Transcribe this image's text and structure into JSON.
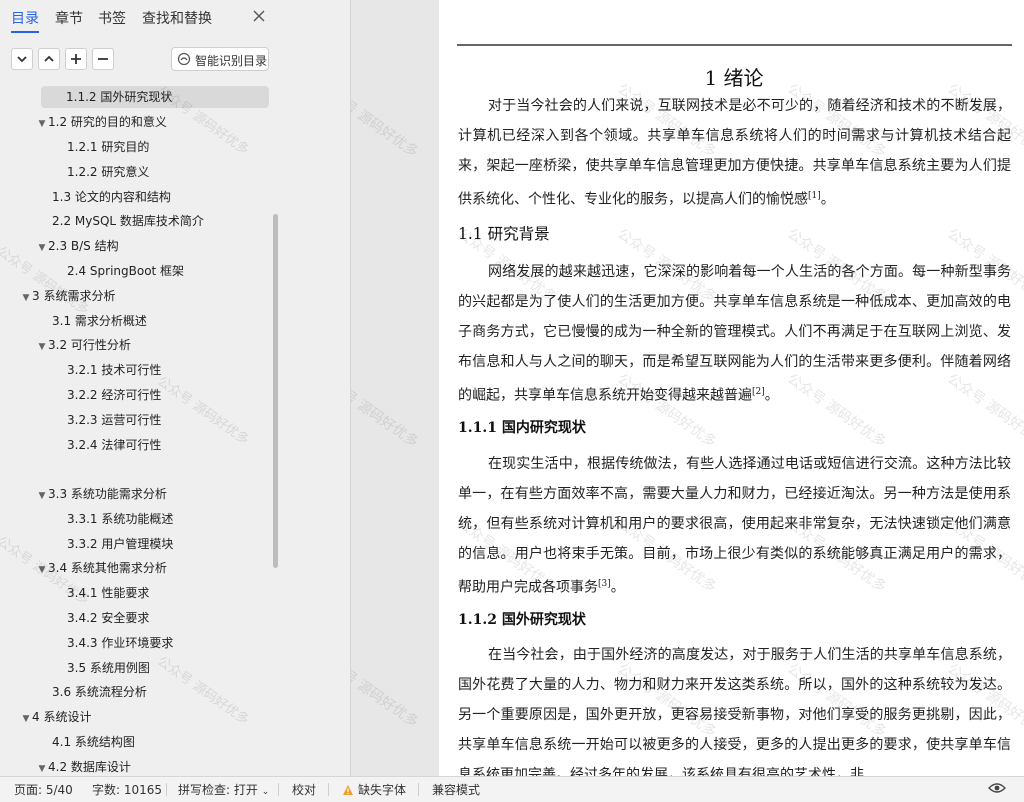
{
  "nav": {
    "tabs": [
      {
        "label": "目录",
        "active": true
      },
      {
        "label": "章节",
        "active": false
      },
      {
        "label": "书签",
        "active": false
      },
      {
        "label": "查找和替换",
        "active": false
      }
    ],
    "close_icon": "close-icon",
    "tool_buttons": [
      "chevron-down-icon",
      "chevron-up-icon",
      "plus-icon",
      "minus-icon"
    ],
    "smart_button_label": "智能识别目录",
    "tree": [
      {
        "label": "1.1.2 国外研究现状",
        "toggle": "",
        "selected": true
      },
      {
        "label": "1.2 研究的目的和意义",
        "toggle": "▼",
        "selected": false
      },
      {
        "label": "1.2.1 研究目的",
        "toggle": "",
        "selected": false
      },
      {
        "label": "1.2.2  研究意义",
        "toggle": "",
        "selected": false
      },
      {
        "label": "1.3  论文的内容和结构",
        "toggle": "",
        "selected": false
      },
      {
        "label": "2.2 MySQL 数据库技术简介",
        "toggle": "",
        "selected": false
      },
      {
        "label": "2.3 B/S 结构",
        "toggle": "▼",
        "selected": false
      },
      {
        "label": "2.4 SpringBoot 框架",
        "toggle": "",
        "selected": false
      },
      {
        "label": "3 系统需求分析",
        "toggle": "▼",
        "selected": false
      },
      {
        "label": "3.1 需求分析概述",
        "toggle": "",
        "selected": false
      },
      {
        "label": "3.2 可行性分析",
        "toggle": "▼",
        "selected": false
      },
      {
        "label": "3.2.1 技术可行性",
        "toggle": "",
        "selected": false
      },
      {
        "label": "3.2.2 经济可行性",
        "toggle": "",
        "selected": false
      },
      {
        "label": "3.2.3 运营可行性",
        "toggle": "",
        "selected": false
      },
      {
        "label": "3.2.4 法律可行性",
        "toggle": "",
        "selected": false
      },
      {
        "label": "3.3 系统功能需求分析",
        "toggle": "▼",
        "selected": false
      },
      {
        "label": "3.3.1 系统功能概述",
        "toggle": "",
        "selected": false
      },
      {
        "label": "3.3.2 用户管理模块",
        "toggle": "",
        "selected": false
      },
      {
        "label": "3.4 系统其他需求分析",
        "toggle": "▼",
        "selected": false
      },
      {
        "label": "3.4.1 性能要求",
        "toggle": "",
        "selected": false
      },
      {
        "label": "3.4.2 安全要求",
        "toggle": "",
        "selected": false
      },
      {
        "label": "3.4.3 作业环境要求",
        "toggle": "",
        "selected": false
      },
      {
        "label": "3.5 系统用例图",
        "toggle": "",
        "selected": false
      },
      {
        "label": "3.6 系统流程分析",
        "toggle": "",
        "selected": false
      },
      {
        "label": "4  系统设计",
        "toggle": "▼",
        "selected": false
      },
      {
        "label": "4.1 系统结构图",
        "toggle": "",
        "selected": false
      },
      {
        "label": "4.2 数据库设计",
        "toggle": "▼",
        "selected": false
      }
    ]
  },
  "document": {
    "title": "1 绪论",
    "intro": "对于当今社会的人们来说，互联网技术是必不可少的，随着经济和技术的不断发展，计算机已经深入到各个领域。共享单车信息系统将人们的时间需求与计算机技术结合起来，架起一座桥梁，使共享单车信息管理更加方便快捷。共享单车信息系统主要为人们提供系统化、个性化、专业化的服务，以提高人们的愉悦感",
    "intro_ref": "[1]",
    "intro_end": "。",
    "h_background": "1.1  研究背景",
    "background": "网络发展的越来越迅速，它深深的影响着每一个人生活的各个方面。每一种新型事务的兴起都是为了使人们的生活更加方便。共享单车信息系统是一种低成本、更加高效的电子商务方式，它已慢慢的成为一种全新的管理模式。人们不再满足于在互联网上浏览、发布信息和人与人之间的聊天，而是希望互联网能为人们的生活带来更多便利。伴随着网络的崛起，共享单车信息系统开始变得越来越普遍",
    "background_ref": "[2]",
    "background_end": "。",
    "h_domestic": "1.1.1 国内研究现状",
    "domestic": "在现实生活中，根据传统做法，有些人选择通过电话或短信进行交流。这种方法比较单一，在有些方面效率不高，需要大量人力和财力，已经接近淘汰。另一种方法是使用系统，但有些系统对计算机和用户的要求很高，使用起来非常复杂，无法快速锁定他们满意的信息。用户也将束手无策。目前，市场上很少有类似的系统能够真正满足用户的需求，帮助用户完成各项事务",
    "domestic_ref": "[3]",
    "domestic_end": "。",
    "h_foreign": "1.1.2 国外研究现状",
    "foreign": "在当今社会，由于国外经济的高度发达，对于服务于人们生活的共享单车信息系统，国外花费了大量的人力、物力和财力来开发这类系统。所以，国外的这种系统较为发达。另一个重要原因是，国外更开放，更容易接受新事物，对他们享受的服务更挑剔，因此，共享单车信息系统一开始可以被更多的人接受，更多的人提出更多的要求，使共享单车信息系统更加完善。经过多年的发展，该系统具有很高的艺术性，非",
    "watermark": "公众号 源码好优多"
  },
  "status": {
    "page": "页面: 5/40",
    "words": "字数: 10165",
    "spell": "拼写检查: 打开",
    "proof": "校对",
    "missing_font": "缺失字体",
    "compat": "兼容模式"
  },
  "colors": {
    "accent": "#2a62e6",
    "warning": "#f0a030"
  }
}
